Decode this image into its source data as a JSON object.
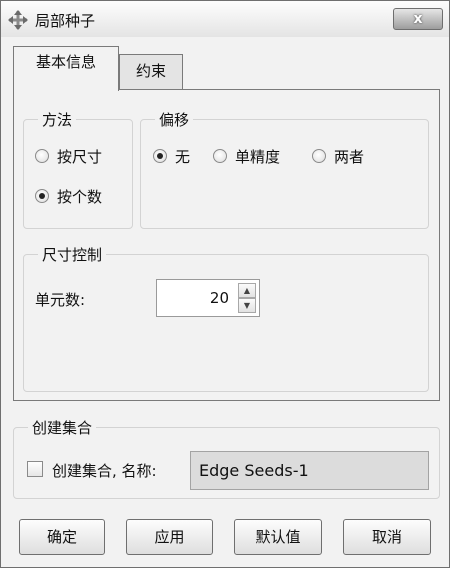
{
  "window": {
    "title": "局部种子",
    "close_label": "x"
  },
  "tabs": [
    {
      "label": "基本信息",
      "active": true
    },
    {
      "label": "约束",
      "active": false
    }
  ],
  "method": {
    "legend": "方法",
    "options": [
      {
        "label": "按尺寸",
        "checked": false
      },
      {
        "label": "按个数",
        "checked": true
      }
    ]
  },
  "bias": {
    "legend": "偏移",
    "options": [
      {
        "label": "无",
        "checked": true
      },
      {
        "label": "单精度",
        "checked": false
      },
      {
        "label": "两者",
        "checked": false
      }
    ]
  },
  "size_control": {
    "legend": "尺寸控制",
    "element_count_label": "单元数:",
    "element_count_value": "20"
  },
  "create_set": {
    "legend": "创建集合",
    "checkbox_label": "创建集合, 名称:",
    "checked": false,
    "name_value": "Edge Seeds-1"
  },
  "buttons": {
    "ok": "确定",
    "apply": "应用",
    "defaults": "默认值",
    "cancel": "取消"
  }
}
